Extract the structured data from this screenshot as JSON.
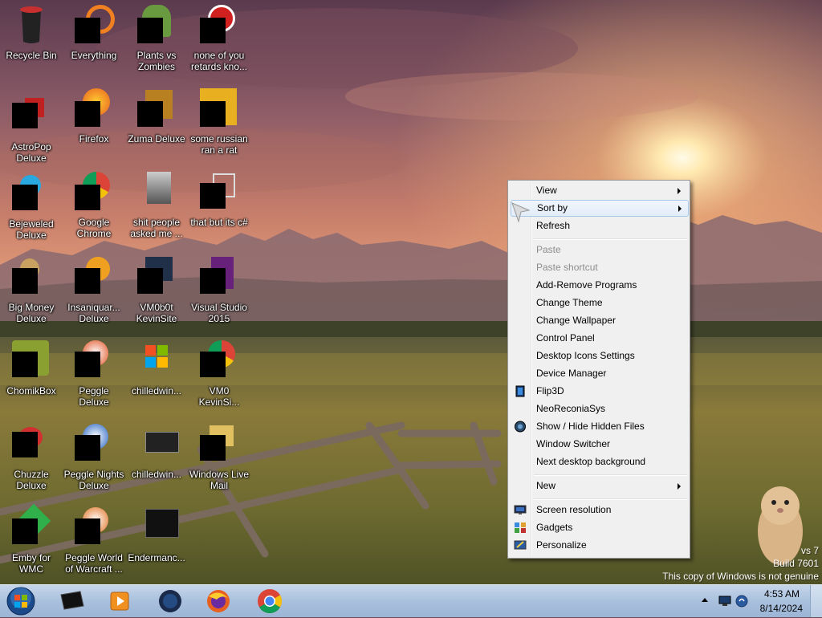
{
  "desktop": {
    "icons": [
      {
        "label": "Recycle Bin",
        "icon": "recycle-bin-icon"
      },
      {
        "label": "Everything",
        "icon": "everything-icon"
      },
      {
        "label": "Plants vs Zombies",
        "icon": "plants-vs-zombies-icon"
      },
      {
        "label": "none of you retards kno...",
        "icon": "game-icon"
      },
      {
        "label": "AstroPop Deluxe",
        "icon": "astropop-icon"
      },
      {
        "label": "Firefox",
        "icon": "firefox-icon"
      },
      {
        "label": "Zuma Deluxe",
        "icon": "zuma-icon"
      },
      {
        "label": "some russian ran a rat",
        "icon": "file-icon"
      },
      {
        "label": "Bejeweled Deluxe",
        "icon": "bejeweled-icon"
      },
      {
        "label": "Google Chrome",
        "icon": "chrome-icon"
      },
      {
        "label": "shit people asked me ...",
        "icon": "folder-icon"
      },
      {
        "label": "that but its c#",
        "icon": "copy-icon"
      },
      {
        "label": "Big Money Deluxe",
        "icon": "big-money-icon"
      },
      {
        "label": "Insaniquar... Deluxe",
        "icon": "insaniquarium-icon"
      },
      {
        "label": "VM0b0t KevinSite",
        "icon": "vm-icon"
      },
      {
        "label": "Visual Studio 2015",
        "icon": "visual-studio-icon"
      },
      {
        "label": "ChomikBox",
        "icon": "chomikbox-icon"
      },
      {
        "label": "Peggle Deluxe",
        "icon": "peggle-icon"
      },
      {
        "label": "chilledwin...",
        "icon": "windows-icon"
      },
      {
        "label": "VM0 KevinSi...",
        "icon": "chrome-icon"
      },
      {
        "label": "Chuzzle Deluxe",
        "icon": "chuzzle-icon"
      },
      {
        "label": "Peggle Nights Deluxe",
        "icon": "peggle-nights-icon"
      },
      {
        "label": "chilledwin...",
        "icon": "video-icon"
      },
      {
        "label": "Windows Live Mail",
        "icon": "mail-icon"
      },
      {
        "label": "Emby for WMC",
        "icon": "emby-icon"
      },
      {
        "label": "Peggle World of Warcraft ...",
        "icon": "peggle-wow-icon"
      },
      {
        "label": "Endermanc...",
        "icon": "window-icon"
      }
    ]
  },
  "context_menu": {
    "items": [
      {
        "label": "View",
        "submenu": true
      },
      {
        "label": "Sort by",
        "submenu": true,
        "highlighted": true
      },
      {
        "label": "Refresh"
      },
      {
        "label": "Paste",
        "disabled": true
      },
      {
        "label": "Paste shortcut",
        "disabled": true
      },
      {
        "label": "Add-Remove Programs"
      },
      {
        "label": "Change Theme"
      },
      {
        "label": "Change Wallpaper"
      },
      {
        "label": "Control Panel"
      },
      {
        "label": "Desktop Icons Settings"
      },
      {
        "label": "Device Manager"
      },
      {
        "label": "Flip3D",
        "icon": "flip3d-icon"
      },
      {
        "label": "NeoReconiaSys"
      },
      {
        "label": "Show / Hide Hidden Files",
        "icon": "globe-icon"
      },
      {
        "label": "Window Switcher"
      },
      {
        "label": "Next desktop background"
      },
      {
        "label": "New",
        "submenu": true
      },
      {
        "label": "Screen resolution",
        "icon": "monitor-icon"
      },
      {
        "label": "Gadgets",
        "icon": "gadgets-icon"
      },
      {
        "label": "Personalize",
        "icon": "personalize-icon"
      }
    ]
  },
  "watermark": {
    "line1": "vs 7",
    "line2": "Build 7601",
    "line3": "This copy of Windows is not genuine"
  },
  "taskbar": {
    "start": "start-orb-icon",
    "pinned": [
      "terminal-icon",
      "media-player-icon",
      "globe-app-icon",
      "firefox-icon",
      "chrome-icon"
    ],
    "time": "4:53 AM",
    "date": "8/14/2024"
  },
  "colors": {
    "menu_bg": "#f0f0f0",
    "menu_highlight": "#e2ecf8",
    "taskbar": "#a9c0dd"
  }
}
